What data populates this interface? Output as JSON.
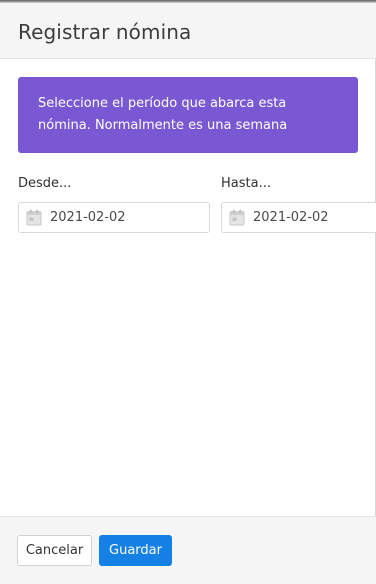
{
  "dialog": {
    "title": "Registrar nómina"
  },
  "alert": {
    "text": "Seleccione el período que abarca esta nómina. Normalmente es una semana",
    "color": "#7b58d3"
  },
  "fields": {
    "from": {
      "label": "Desde...",
      "value": "2021-02-02",
      "icon": "calendar-icon"
    },
    "to": {
      "label": "Hasta...",
      "value": "2021-02-02",
      "icon": "calendar-icon"
    }
  },
  "footer": {
    "cancel_label": "Cancelar",
    "save_label": "Guardar",
    "save_color": "#1580e6"
  }
}
